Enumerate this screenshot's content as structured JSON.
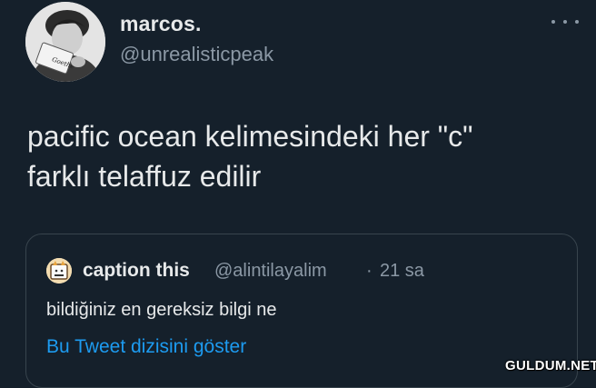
{
  "author": {
    "display_name": "marcos.",
    "handle": "@unrealisticpeak",
    "avatar_icon": "profile-photo"
  },
  "tweet": {
    "text_line1": "pacific ocean kelimesindeki her \"c\"",
    "text_line2": "farklı telaffuz edilir"
  },
  "quoted_tweet": {
    "display_name": "caption this",
    "handle": "@alintilayalim",
    "separator": "·",
    "time": "21 sa",
    "text": "bildiğiniz en gereksiz bilgi ne",
    "thread_link": "Bu Tweet dizisini göster"
  },
  "watermark": "GULDUM.NET",
  "colors": {
    "background": "#15202b",
    "text": "#e7e9ea",
    "secondary": "#8b98a5",
    "link": "#1d9bf0",
    "border": "#38444d"
  }
}
